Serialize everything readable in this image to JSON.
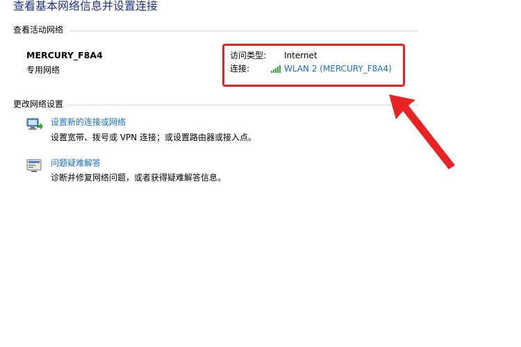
{
  "page": {
    "title": "查看基本网络信息并设置连接"
  },
  "active_networks": {
    "header": "查看活动网络",
    "network_name": "MERCURY_F8A4",
    "network_type": "专用网络",
    "access_type_label": "访问类型:",
    "access_type_value": "Internet",
    "connection_label": "连接:",
    "connection_value": "WLAN 2 (MERCURY_F8A4)"
  },
  "change_settings": {
    "header": "更改网络设置",
    "items": [
      {
        "link": "设置新的连接或网络",
        "description": "设置宽带、拨号或 VPN 连接；或设置路由器或接入点。",
        "icon": "network-setup-icon"
      },
      {
        "link": "问题疑难解答",
        "description": "诊断并修复网络问题，或者获得疑难解答信息。",
        "icon": "troubleshoot-icon"
      }
    ]
  },
  "colors": {
    "title": "#1e3287",
    "link": "#1a6fbf",
    "annotation": "#e32222",
    "signal": "#3aa53a"
  }
}
